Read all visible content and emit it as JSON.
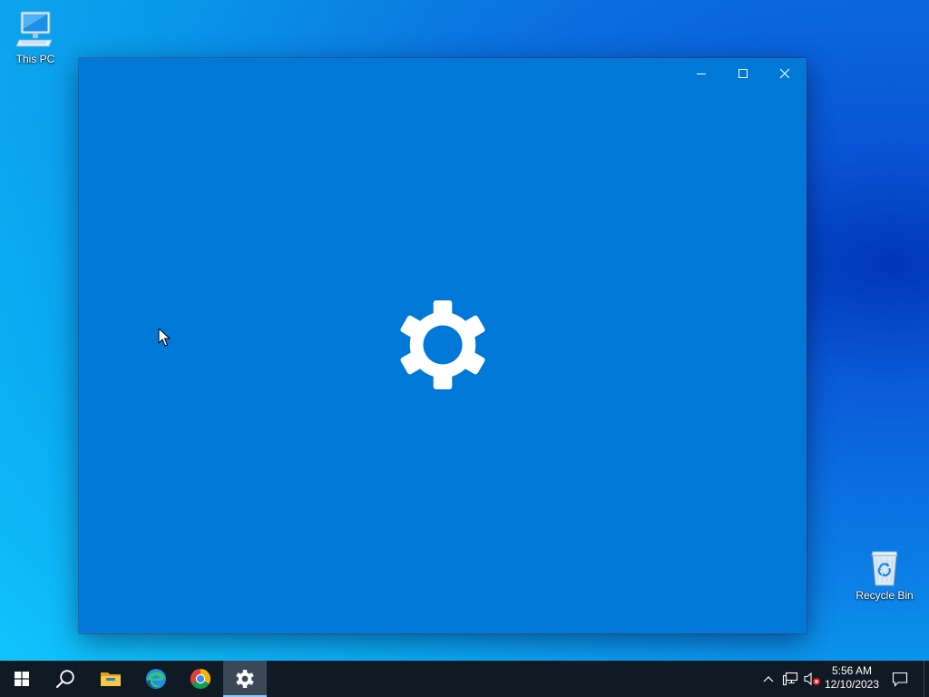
{
  "desktop": {
    "icons": [
      {
        "label": "This PC",
        "icon": "monitor-icon"
      },
      {
        "label": "Recycle Bin",
        "icon": "recycle-bin-icon"
      }
    ]
  },
  "window": {
    "app": "Settings",
    "state": "loading",
    "splash_icon": "gear-icon",
    "background_color": "#0078d7",
    "caption_buttons": [
      "minimize-icon",
      "maximize-icon",
      "close-icon"
    ]
  },
  "taskbar": {
    "background_color": "#101a24",
    "items": [
      {
        "name": "start",
        "icon": "windows-logo-icon"
      },
      {
        "name": "search",
        "icon": "search-icon"
      },
      {
        "name": "file-explorer",
        "icon": "folder-icon"
      },
      {
        "name": "edge",
        "icon": "edge-icon"
      },
      {
        "name": "chrome",
        "icon": "chrome-icon"
      },
      {
        "name": "settings",
        "icon": "gear-icon",
        "active": true
      }
    ],
    "tray": {
      "icons": [
        "chevron-up-icon",
        "network-icon",
        "volume-muted-icon"
      ],
      "time": "5:56 AM",
      "date": "12/10/2023",
      "notification_icon": "action-center-icon"
    }
  }
}
